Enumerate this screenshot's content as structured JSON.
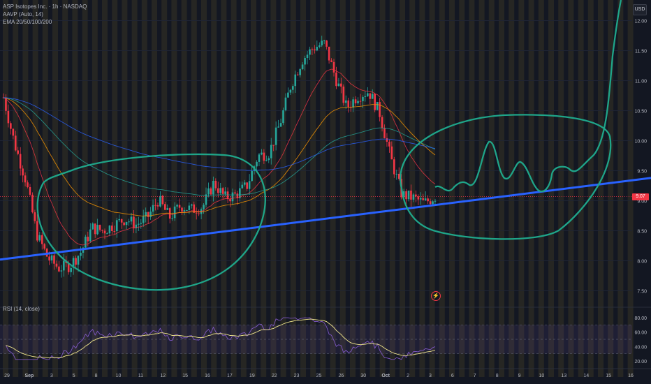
{
  "header": {
    "symbol_line": "ASP Isotopes Inc. · 1h · NASDAQ",
    "indicator_1": "AAVP (Auto, 14)",
    "indicator_2": "EMA 20/50/100/200",
    "rsi_label": "RSI (14, close)",
    "currency": "USD",
    "last_price": "9.07"
  },
  "colors": {
    "background": "#131722",
    "up": "#26a69a",
    "down": "#f23645",
    "trendline": "#2962ff",
    "drawing": "#1fa589",
    "rsi_line": "#7e57c2",
    "rsi_ma": "#f0e68c"
  },
  "chart_data": [
    {
      "type": "candlestick",
      "x_ticks": [
        "29",
        "Sep",
        "3",
        "5",
        "8",
        "10",
        "11",
        "12",
        "15",
        "16",
        "17",
        "19",
        "22",
        "23",
        "25",
        "26",
        "30",
        "Oct",
        "2",
        "3",
        "6",
        "7",
        "8",
        "9",
        "10",
        "13",
        "14",
        "15",
        "16"
      ],
      "y_ticks": [
        7.5,
        8.0,
        8.5,
        9.0,
        9.5,
        10.0,
        10.5,
        11.0,
        11.5,
        12.0
      ],
      "ylim": [
        7.25,
        12.25
      ],
      "close_path": [
        [
          0,
          10.72
        ],
        [
          1,
          9.95
        ],
        [
          2,
          9.35
        ],
        [
          3,
          8.45
        ],
        [
          4,
          8.05
        ],
        [
          5,
          7.88
        ],
        [
          6,
          7.92
        ],
        [
          7,
          8.15
        ],
        [
          8,
          8.55
        ],
        [
          9,
          8.5
        ],
        [
          10,
          8.6
        ],
        [
          11,
          8.7
        ],
        [
          12,
          8.6
        ],
        [
          13,
          8.72
        ],
        [
          14,
          9.02
        ],
        [
          15,
          8.72
        ],
        [
          16,
          8.92
        ],
        [
          17,
          8.85
        ],
        [
          18,
          8.9
        ],
        [
          19,
          9.3
        ],
        [
          20,
          9.05
        ],
        [
          21,
          9.1
        ],
        [
          22,
          9.25
        ],
        [
          23,
          9.75
        ],
        [
          24,
          9.8
        ],
        [
          25,
          10.3
        ],
        [
          26,
          10.95
        ],
        [
          27,
          11.35
        ],
        [
          28,
          11.55
        ],
        [
          29,
          11.62
        ],
        [
          30,
          11.05
        ],
        [
          31,
          10.55
        ],
        [
          32,
          10.75
        ],
        [
          33,
          10.82
        ],
        [
          34,
          10.45
        ],
        [
          35,
          9.7
        ],
        [
          36,
          9.1
        ],
        [
          37,
          9.05
        ],
        [
          38,
          8.96
        ],
        [
          39,
          9.07
        ]
      ],
      "trendline": {
        "start": [
          8.02
        ],
        "end": [
          9.38
        ]
      },
      "annotations": [
        "ellipse",
        "ellipse",
        "projection-path"
      ]
    },
    {
      "type": "line",
      "name": "RSI (14, close)",
      "y_ticks": [
        20.0,
        40.0,
        60.0,
        80.0
      ],
      "ylim": [
        15,
        85
      ],
      "upper_band": 70,
      "lower_band": 30
    }
  ]
}
